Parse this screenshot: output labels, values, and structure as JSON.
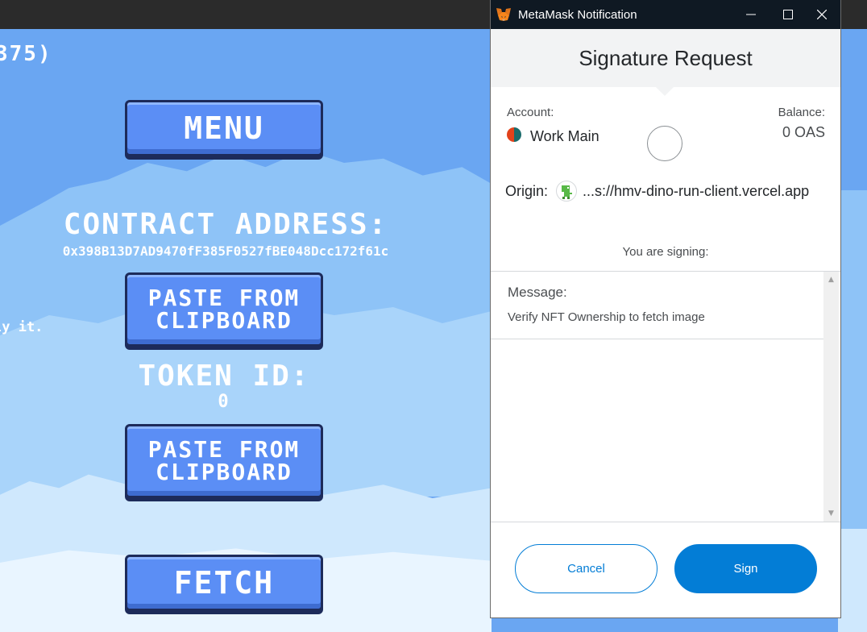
{
  "game": {
    "top_partial_text": "375)",
    "menu_button": "MENU",
    "contract_address_heading": "CONTRACT ADDRESS:",
    "contract_address_value": "0x398B13D7AD9470fF385F0527fBE048Dcc172f61c",
    "paste_button_1_line1": "PASTE FROM",
    "paste_button_1_line2": "CLIPBOARD",
    "side_partial_text": "ly it.",
    "token_id_heading": "TOKEN ID:",
    "token_id_value": "0",
    "paste_button_2_line1": "PASTE FROM",
    "paste_button_2_line2": "CLIPBOARD",
    "fetch_button": "FETCH"
  },
  "metamask": {
    "window_title": "MetaMask Notification",
    "header_title": "Signature Request",
    "account_label": "Account:",
    "account_name": "Work Main",
    "balance_label": "Balance:",
    "balance_value": "0 OAS",
    "origin_label": "Origin:",
    "origin_value": "...s://hmv-dino-run-client.vercel.app",
    "signing_label": "You are signing:",
    "message_label": "Message:",
    "message_value": "Verify NFT Ownership to fetch image",
    "cancel_label": "Cancel",
    "sign_label": "Sign",
    "colors": {
      "primary": "#037dd6",
      "header_bg": "#f2f3f4",
      "titlebar_bg": "#0f1923"
    }
  }
}
